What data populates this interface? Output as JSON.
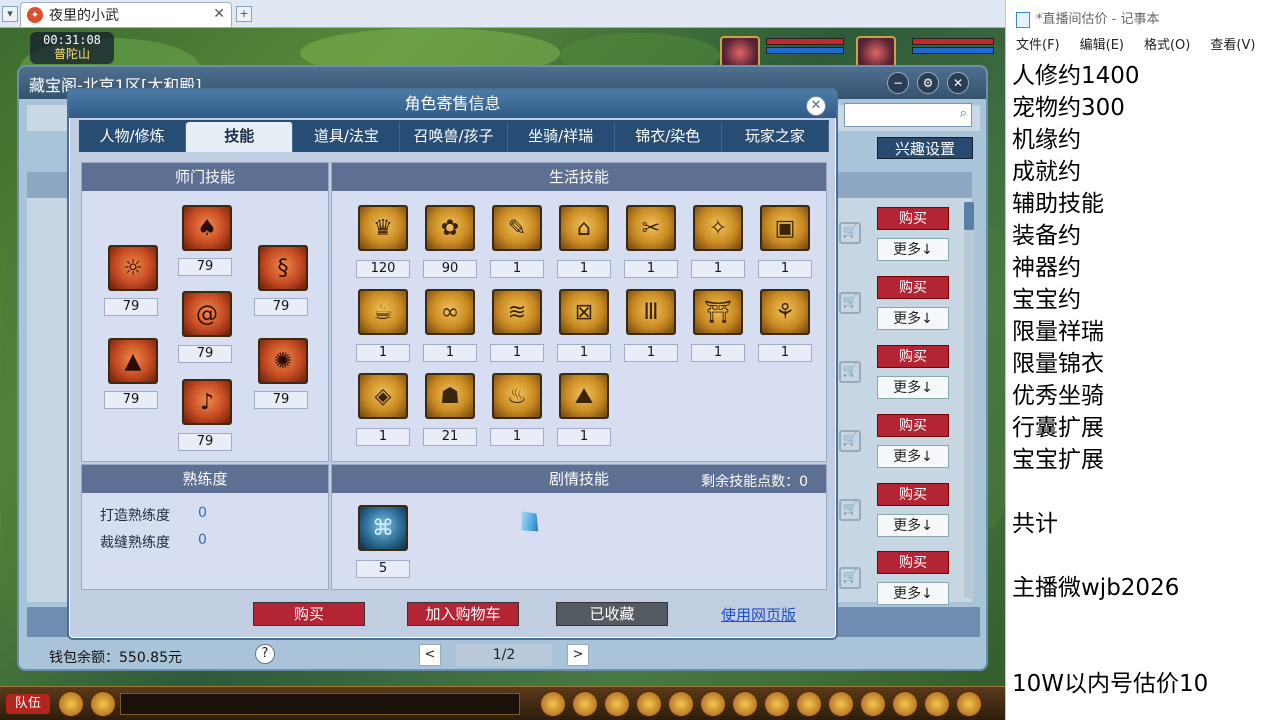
{
  "browser": {
    "tab_title": "夜里的小武",
    "tab_icon": "game-flame-icon",
    "tab_close": "✕",
    "add_tab": "+"
  },
  "game": {
    "clock": "00:31:08",
    "location": "普陀山",
    "hud_team": "队伍"
  },
  "outer_window": {
    "title": "藏宝阁-北京1区[太和殿]",
    "interest_button": "兴趣设置",
    "buy_label": "购买",
    "more_label": "更多↓",
    "wallet": "钱包余额：550.85元",
    "help": "?",
    "page": "1/2",
    "prev": "<",
    "next": ">"
  },
  "dialog": {
    "title": "角色寄售信息",
    "close": "✕",
    "tabs": [
      "人物/修炼",
      "技能",
      "道具/法宝",
      "召唤兽/孩子",
      "坐骑/祥瑞",
      "锦衣/染色",
      "玩家之家"
    ],
    "active_tab": "技能",
    "shimen": {
      "header": "师门技能",
      "levels": [
        "79",
        "79",
        "79",
        "79",
        "79",
        "79",
        "79"
      ]
    },
    "life": {
      "header": "生活技能",
      "levels": [
        "120",
        "90",
        "1",
        "1",
        "1",
        "1",
        "1",
        "1",
        "1",
        "1",
        "1",
        "1",
        "1",
        "1",
        "1",
        "21",
        "1",
        "1"
      ]
    },
    "proficiency": {
      "header": "熟练度",
      "forge_label": "打造熟练度",
      "forge_value": "0",
      "tailor_label": "裁缝熟练度",
      "tailor_value": "0"
    },
    "story": {
      "header": "剧情技能",
      "remaining_label": "剩余技能点数：",
      "remaining_value": "0",
      "levels": [
        "5"
      ]
    },
    "buttons": {
      "buy": "购买",
      "add_cart": "加入购物车",
      "collected": "已收藏",
      "web_version": "使用网页版"
    }
  },
  "notepad": {
    "title": "*直播间估价 - 记事本",
    "menu": [
      "文件(F)",
      "编辑(E)",
      "格式(O)",
      "查看(V)"
    ],
    "lines": [
      "人修约1400",
      "宠物约300",
      "机缘约",
      "成就约",
      "辅助技能",
      "装备约",
      "神器约",
      "宝宝约",
      "限量祥瑞",
      "限量锦衣",
      "优秀坐骑",
      "行囊扩展",
      "宝宝扩展",
      "",
      "共计",
      "",
      "主播微wjb2026",
      "",
      "",
      "10W以内号估价10"
    ]
  },
  "colors": {
    "buy_red": "#b32434",
    "dialog_blue": "#305b86",
    "link_blue": "#1d4fc9"
  }
}
